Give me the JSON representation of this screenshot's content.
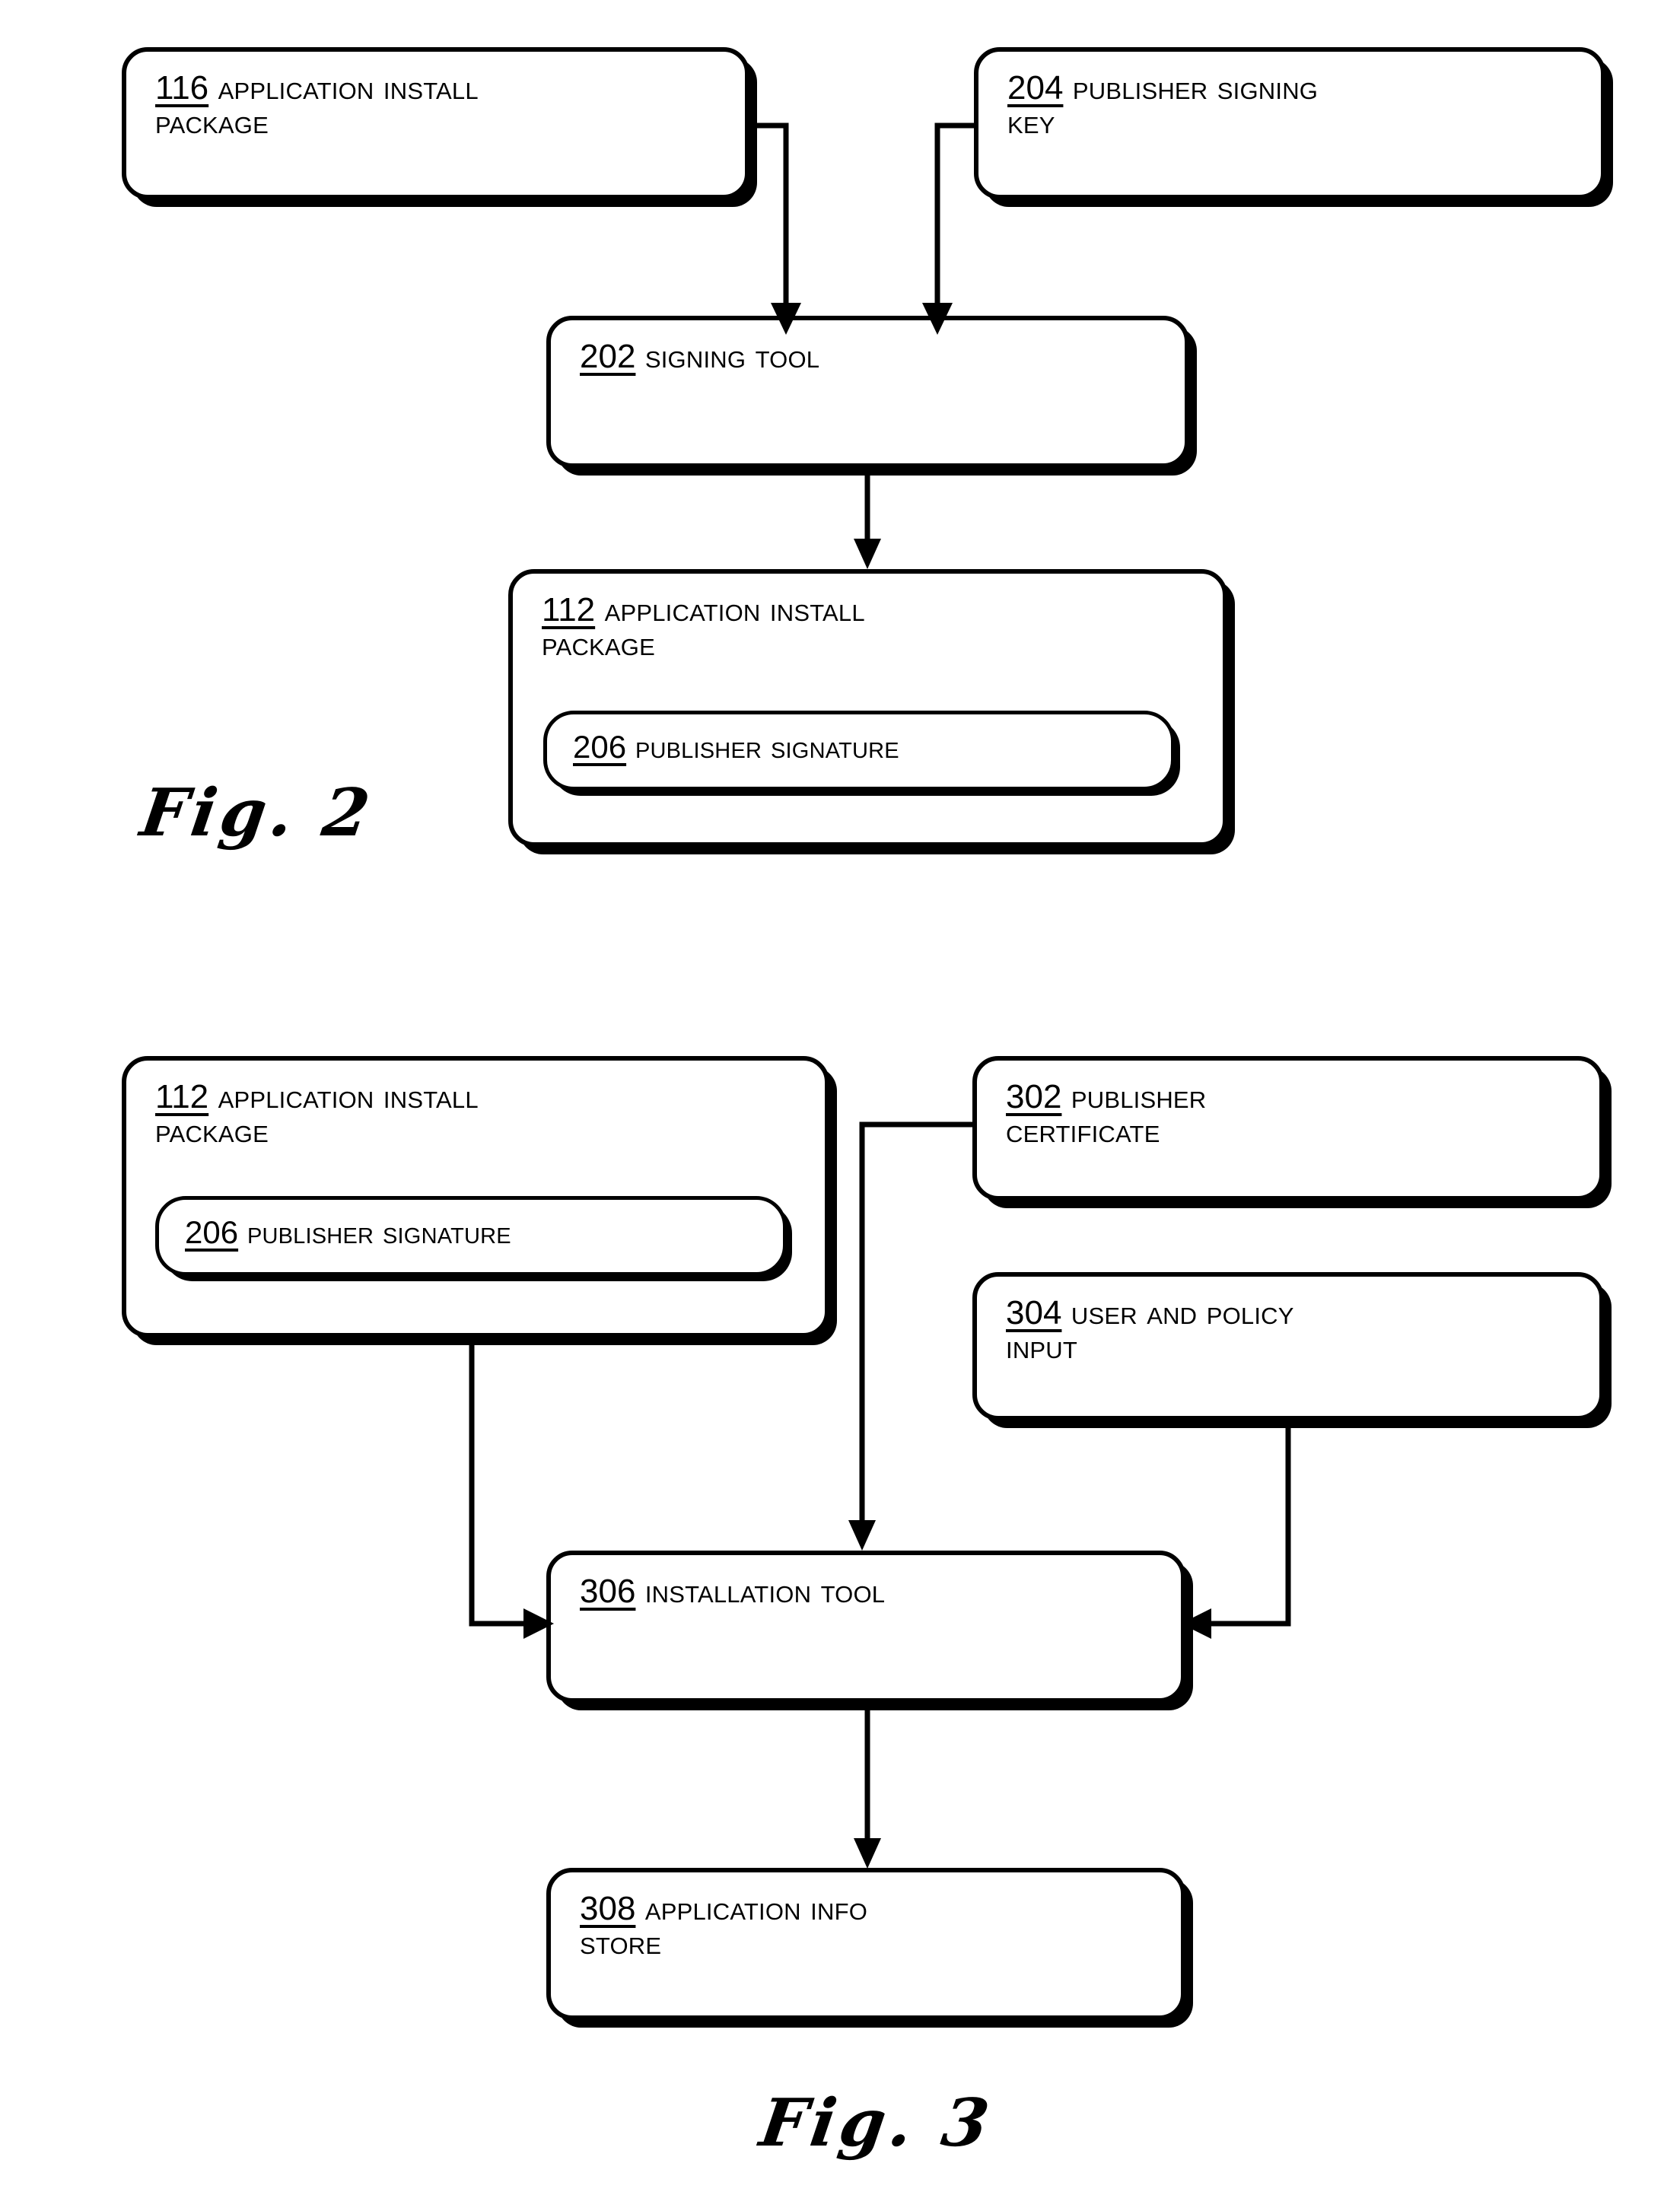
{
  "document": {
    "type": "patent-drawing-sheet",
    "figure_count": 2
  },
  "figures": [
    {
      "id": "fig2",
      "caption": "Fig. 2",
      "boxes": [
        {
          "id": "b116",
          "ref": "116",
          "label": "Application Install\nPackage",
          "full": "116 Application Install Package"
        },
        {
          "id": "b204",
          "ref": "204",
          "label": "Publisher Signing\nKey",
          "full": "204 Publisher Signing Key"
        },
        {
          "id": "b202",
          "ref": "202",
          "label": "Signing Tool",
          "full": "202 Signing Tool"
        },
        {
          "id": "b112",
          "ref": "112",
          "label": "Application Install\nPackage",
          "full": "112 Application Install Package"
        },
        {
          "id": "b206",
          "ref": "206",
          "label": "Publisher Signature",
          "full": "206 Publisher Signature"
        }
      ],
      "connections": [
        {
          "from": "116",
          "to": "202",
          "arrow": "to"
        },
        {
          "from": "204",
          "to": "202",
          "arrow": "to"
        },
        {
          "from": "202",
          "to": "112",
          "arrow": "to"
        }
      ]
    },
    {
      "id": "fig3",
      "caption": "Fig. 3",
      "boxes": [
        {
          "id": "b112",
          "ref": "112",
          "label": "Application Install\nPackage",
          "full": "112 Application Install Package"
        },
        {
          "id": "b206",
          "ref": "206",
          "label": "Publisher Signature",
          "full": "206 Publisher Signature"
        },
        {
          "id": "b302",
          "ref": "302",
          "label": "Publisher\nCertificate",
          "full": "302 Publisher Certificate"
        },
        {
          "id": "b304",
          "ref": "304",
          "label": "User and Policy\nInput",
          "full": "304 User and Policy Input"
        },
        {
          "id": "b306",
          "ref": "306",
          "label": "Installation Tool",
          "full": "306 Installation Tool"
        },
        {
          "id": "b308",
          "ref": "308",
          "label": "Application Info\nStore",
          "full": "308 Application Info Store"
        }
      ],
      "connections": [
        {
          "from": "112",
          "to": "306",
          "arrow": "to"
        },
        {
          "from": "302",
          "to": "306",
          "arrow": "to"
        },
        {
          "from": "304",
          "to": "306",
          "arrow": "to"
        },
        {
          "from": "306",
          "to": "308",
          "arrow": "to"
        }
      ]
    }
  ],
  "colors": {
    "ink": "#000000",
    "paper": "#ffffff"
  }
}
